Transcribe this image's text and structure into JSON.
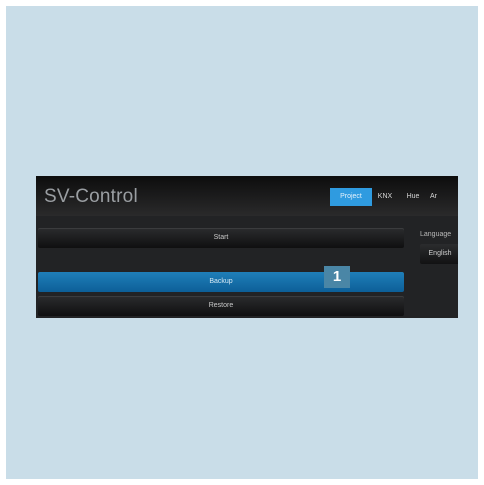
{
  "app": {
    "title": "SV-Control"
  },
  "tabs": [
    {
      "label": "Project",
      "active": true
    },
    {
      "label": "KNX",
      "active": false
    },
    {
      "label": "Hue",
      "active": false
    },
    {
      "label": "Ar",
      "active": false
    }
  ],
  "main": {
    "start_label": "Start",
    "backup_label": "Backup",
    "restore_label": "Restore"
  },
  "callout": {
    "number": "1"
  },
  "settings": {
    "language_label": "Language",
    "language_value": "English"
  },
  "colors": {
    "background": "#c9dde8",
    "accent": "#2f9be0",
    "selected_button": "#137ab3",
    "callout": "#4a86a6"
  }
}
